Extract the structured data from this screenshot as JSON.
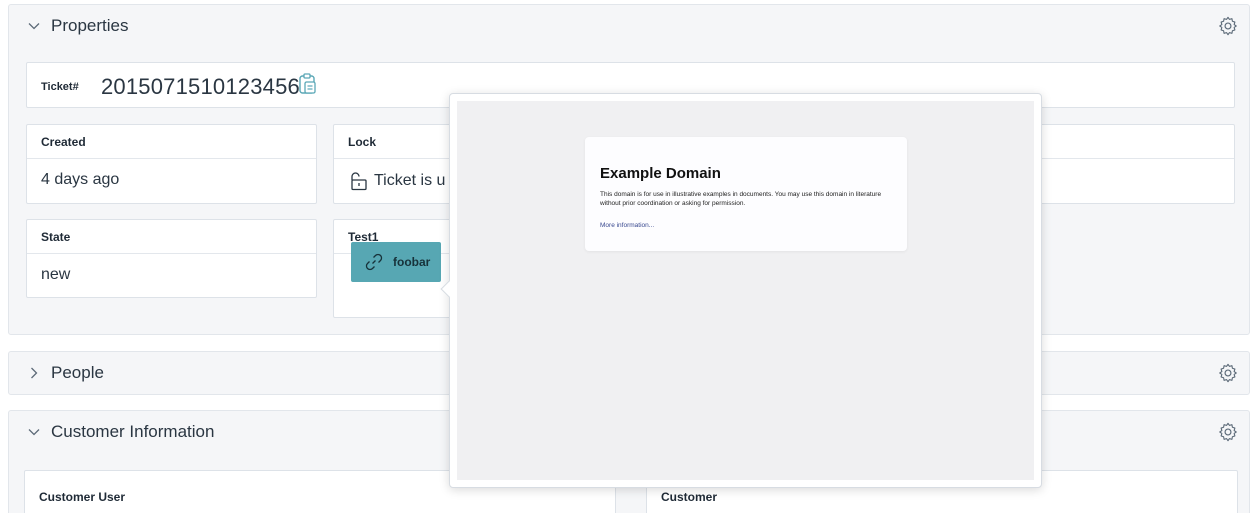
{
  "properties": {
    "title": "Properties",
    "ticket_label": "Ticket#",
    "ticket_number": "2015071510123456",
    "fields": {
      "created": {
        "label": "Created",
        "value": "4 days ago"
      },
      "lock": {
        "label": "Lock",
        "value": "Ticket is u"
      },
      "state": {
        "label": "State",
        "value": "new"
      },
      "test1": {
        "label": "Test1",
        "link_label": "foobar"
      }
    }
  },
  "people": {
    "title": "People"
  },
  "customer_information": {
    "title": "Customer Information",
    "customer_user_label": "Customer User",
    "customer_label": "Customer"
  },
  "preview": {
    "heading": "Example Domain",
    "body": "This domain is for use in illustrative examples in documents. You may use this domain in literature without prior coordination or asking for permission.",
    "link": "More information..."
  },
  "colors": {
    "accent": "#57a7b3",
    "panel_bg": "#f5f6f8"
  }
}
